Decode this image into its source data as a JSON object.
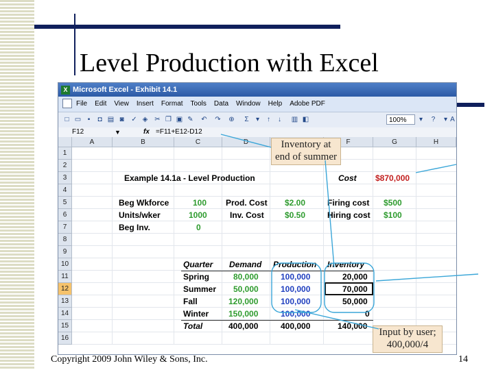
{
  "slide": {
    "title": "Level Production with Excel",
    "footer": "Copyright 2009 John Wiley & Sons, Inc.",
    "page_number": "14"
  },
  "window": {
    "title": "Microsoft Excel - Exhibit 14.1",
    "app_icon": "excel-icon"
  },
  "menu": [
    "File",
    "Edit",
    "View",
    "Insert",
    "Format",
    "Tools",
    "Data",
    "Window",
    "Help",
    "Adobe PDF"
  ],
  "toolbar": {
    "zoom": "100%",
    "sigma": "Σ",
    "help": "?",
    "trailing": "A"
  },
  "formula_bar": {
    "name_box": "F12",
    "fx": "fx",
    "formula": "=F11+E12-D12"
  },
  "columns": [
    "A",
    "B",
    "C",
    "D",
    "E",
    "F",
    "G",
    "H"
  ],
  "rows": [
    "1",
    "2",
    "3",
    "4",
    "5",
    "6",
    "7",
    "8",
    "9",
    "10",
    "11",
    "12",
    "13",
    "14",
    "15",
    "16"
  ],
  "selected_row": "12",
  "sheet": {
    "heading": "Example 14.1a - Level Production",
    "cost_label": "Cost",
    "cost_value": "$870,000",
    "beg_wkforce_label": "Beg Wkforce",
    "beg_wkforce_value": "100",
    "units_wker_label": "Units/wker",
    "units_wker_value": "1000",
    "beg_inv_label": "Beg Inv.",
    "beg_inv_value": "0",
    "prod_cost_label": "Prod. Cost",
    "prod_cost_value": "$2.00",
    "inv_cost_label": "Inv. Cost",
    "inv_cost_value": "$0.50",
    "firing_cost_label": "Firing cost",
    "firing_cost_value": "$500",
    "hiring_cost_label": "Hiring cost",
    "hiring_cost_value": "$100",
    "table_headers": [
      "Quarter",
      "Demand",
      "Production",
      "Inventory"
    ],
    "table_rows": [
      {
        "quarter": "Spring",
        "demand": "80,000",
        "production": "100,000",
        "inventory": "20,000"
      },
      {
        "quarter": "Summer",
        "demand": "50,000",
        "production": "100,000",
        "inventory": "70,000"
      },
      {
        "quarter": "Fall",
        "demand": "120,000",
        "production": "100,000",
        "inventory": "50,000"
      },
      {
        "quarter": "Winter",
        "demand": "150,000",
        "production": "100,000",
        "inventory": "0"
      }
    ],
    "total": {
      "quarter": "Total",
      "demand": "400,000",
      "production": "400,000",
      "inventory": "140,000"
    }
  },
  "callouts": {
    "inventory_line1": "Inventory at",
    "inventory_line2": "end of summer",
    "input_line1": "Input by user;",
    "input_line2": "400,000/4"
  },
  "colors": {
    "navy_bar": "#0f1f5c",
    "green_value": "#2e9b2e",
    "blue_value": "#1f3fbf",
    "red_value": "#c21f1f",
    "callout_fill": "#f7e6cf",
    "highlight_row": "#f5c26b"
  }
}
